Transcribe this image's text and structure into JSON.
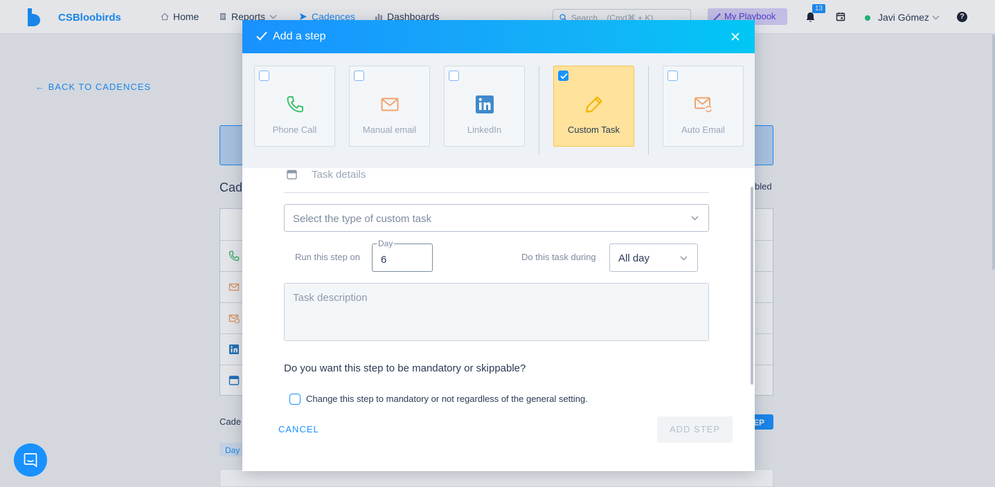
{
  "nav": {
    "brand": "CSBloobirds",
    "items": [
      {
        "label": "Home"
      },
      {
        "label": "Reports"
      },
      {
        "label": "Cadences"
      },
      {
        "label": "Dashboards"
      }
    ],
    "search_placeholder": "Search... (Cmd⌘ + K)",
    "playbook_label": "My Playbook",
    "notification_count": "13",
    "user_name": "Javi Gómez",
    "help_label": "?"
  },
  "background": {
    "back_link": "← BACK TO CADENCES",
    "heading_partial": "Cad",
    "enabled_partial": "bled",
    "cadence_label_partial": "Cade",
    "button_partial": "EP",
    "day_label": "Day"
  },
  "modal": {
    "title": "Add a step",
    "step_types": [
      {
        "label": "Phone Call",
        "icon": "phone-icon",
        "checked": false
      },
      {
        "label": "Manual email",
        "icon": "email-icon",
        "checked": false
      },
      {
        "label": "LinkedIn",
        "icon": "linkedin-icon",
        "checked": false
      },
      {
        "label": "Custom Task",
        "icon": "pencil-icon",
        "checked": true
      },
      {
        "label": "Auto Email",
        "icon": "auto-email-icon",
        "checked": false
      }
    ],
    "section_title": "Task details",
    "custom_task_placeholder": "Select the type of custom task",
    "run_label": "Run this step on",
    "day_label": "Day",
    "day_value": "6",
    "during_label": "Do this task during",
    "during_value": "All day",
    "description_placeholder": "Task description",
    "mandatory_question": "Do you want this step to be mandatory or skippable?",
    "mandatory_checkbox_label": "Change this step to mandatory or not regardless of the general setting.",
    "cancel_label": "CANCEL",
    "add_label": "ADD STEP"
  },
  "colors": {
    "accent": "#1991ff",
    "selected_card": "#ffe29c",
    "phone": "#3fbf6b",
    "email": "#f3a26a",
    "linkedin": "#1f77c4",
    "pencil": "#f2b400"
  }
}
